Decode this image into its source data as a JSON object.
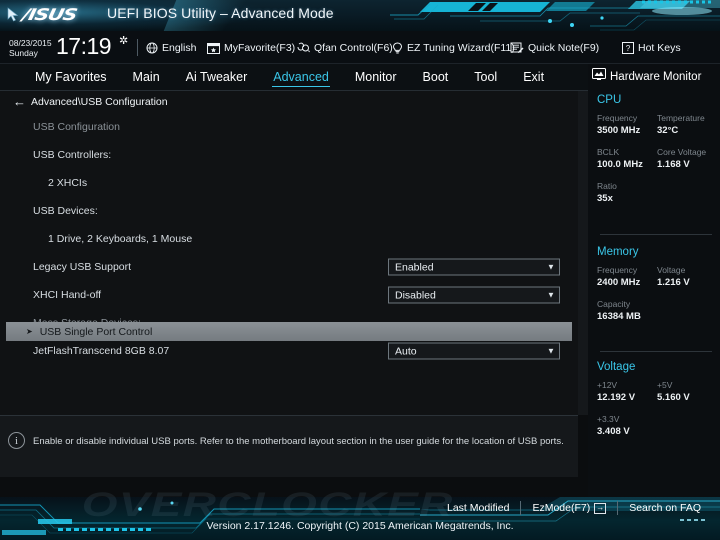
{
  "window": {
    "brand": "/ISUS",
    "title": "UEFI BIOS Utility – Advanced Mode"
  },
  "infobar": {
    "date": "08/23/2015",
    "day": "Sunday",
    "time": "17:19",
    "gear_icon": "gear-icon",
    "tools": [
      {
        "icon": "globe-icon",
        "label": "English"
      },
      {
        "icon": "star-window-icon",
        "label": "MyFavorite(F3)"
      },
      {
        "icon": "fan-icon",
        "label": "Qfan Control(F6)"
      },
      {
        "icon": "bulb-icon",
        "label": "EZ Tuning Wizard(F11)"
      },
      {
        "icon": "note-pencil-icon",
        "label": "Quick Note(F9)"
      },
      {
        "icon": "question-box-icon",
        "label": "Hot Keys"
      }
    ]
  },
  "nav": {
    "active": "Advanced",
    "tabs": [
      {
        "label": "My Favorites"
      },
      {
        "label": "Main"
      },
      {
        "label": "Ai Tweaker"
      },
      {
        "label": "Advanced"
      },
      {
        "label": "Monitor"
      },
      {
        "label": "Boot"
      },
      {
        "label": "Tool"
      },
      {
        "label": "Exit"
      }
    ]
  },
  "main": {
    "back_icon": "back-arrow-icon",
    "breadcrumb": "Advanced\\USB Configuration",
    "rows": [
      {
        "kind": "heading",
        "label": "USB Configuration"
      },
      {
        "kind": "heading",
        "label": "USB Controllers:"
      },
      {
        "kind": "value",
        "label": "2 XHCIs"
      },
      {
        "kind": "heading",
        "label": "USB Devices:"
      },
      {
        "kind": "value",
        "label": "1 Drive, 2 Keyboards, 1 Mouse"
      },
      {
        "kind": "setting",
        "label": "Legacy USB Support",
        "value": "Enabled"
      },
      {
        "kind": "setting",
        "label": "XHCI Hand-off",
        "value": "Disabled"
      },
      {
        "kind": "heading",
        "label": "Mass Storage Devices:"
      },
      {
        "kind": "setting",
        "label": "JetFlashTranscend 8GB 8.07",
        "value": "Auto"
      }
    ],
    "selected_item": {
      "arrow_icon": "submenu-arrow-icon",
      "label": "USB Single Port Control"
    }
  },
  "help": {
    "icon": "info-icon",
    "text": "Enable or disable individual USB ports. Refer to the motherboard layout section in the user guide for the location of USB ports."
  },
  "sidebar": {
    "icon": "monitor-icon",
    "title": "Hardware Monitor",
    "sections": [
      {
        "title": "CPU",
        "rows": [
          [
            {
              "key": "Frequency",
              "value": "3500 MHz"
            },
            {
              "key": "Temperature",
              "value": "32°C"
            }
          ],
          [
            {
              "key": "BCLK",
              "value": "100.0 MHz"
            },
            {
              "key": "Core Voltage",
              "value": "1.168 V"
            }
          ],
          [
            {
              "key": "Ratio",
              "value": "35x"
            }
          ]
        ]
      },
      {
        "title": "Memory",
        "rows": [
          [
            {
              "key": "Frequency",
              "value": "2400 MHz"
            },
            {
              "key": "Voltage",
              "value": "1.216 V"
            }
          ],
          [
            {
              "key": "Capacity",
              "value": "16384 MB"
            }
          ]
        ]
      },
      {
        "title": "Voltage",
        "rows": [
          [
            {
              "key": "+12V",
              "value": "12.192 V"
            },
            {
              "key": "+5V",
              "value": "5.160 V"
            }
          ],
          [
            {
              "key": "+3.3V",
              "value": "3.408 V"
            }
          ]
        ]
      }
    ]
  },
  "footer": {
    "watermark": "OVERCLOCKER",
    "links": [
      {
        "label": "Last Modified"
      },
      {
        "label": "EzMode(F7)",
        "icon": "arrow-in-box-icon"
      },
      {
        "label": "Search on FAQ"
      }
    ],
    "version": "Version 2.17.1246. Copyright (C) 2015 American Megatrends, Inc."
  },
  "colors": {
    "accent": "#3ac6e8",
    "panel": "#101214",
    "highlight": "#7d8389"
  }
}
